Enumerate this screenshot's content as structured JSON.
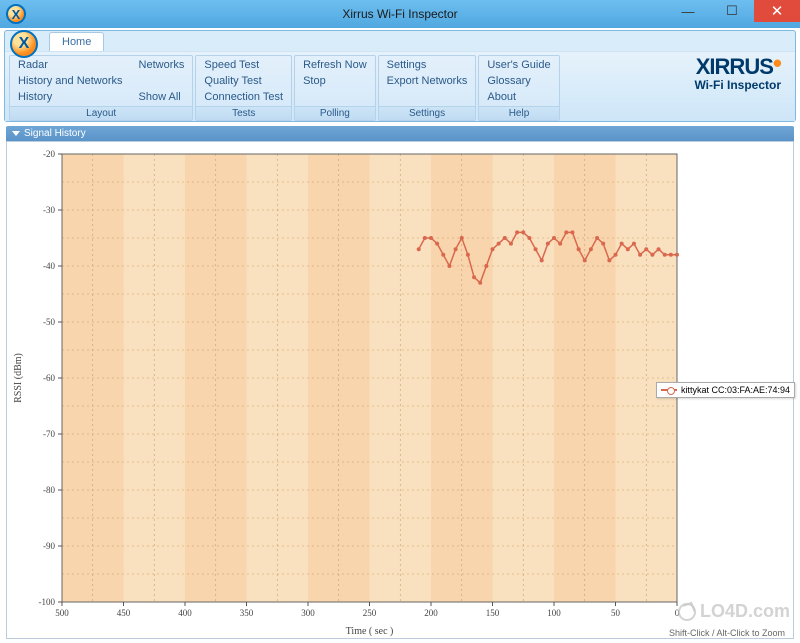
{
  "window": {
    "title": "Xirrus Wi-Fi Inspector"
  },
  "ribbon": {
    "file_tab": "Home",
    "groups": {
      "layout": {
        "label": "Layout",
        "col1": [
          "Radar",
          "History and Networks",
          "History"
        ],
        "col2": [
          "Networks",
          "",
          "Show All"
        ]
      },
      "tests": {
        "label": "Tests",
        "items": [
          "Speed Test",
          "Quality Test",
          "Connection Test"
        ]
      },
      "polling": {
        "label": "Polling",
        "items": [
          "Refresh Now",
          "Stop"
        ]
      },
      "settings": {
        "label": "Settings",
        "items": [
          "Settings",
          "Export Networks"
        ]
      },
      "help": {
        "label": "Help",
        "items": [
          "User's Guide",
          "Glossary",
          "About"
        ]
      }
    },
    "logo": {
      "name": "XIRRUS",
      "sub": "Wi-Fi Inspector"
    }
  },
  "panel": {
    "title": "Signal History"
  },
  "chart_data": {
    "type": "line",
    "title": "",
    "xlabel": "Time ( sec )",
    "ylabel": "RSSI (dBm)",
    "xlim": [
      500,
      0
    ],
    "ylim": [
      -100,
      -20
    ],
    "x_ticks": [
      500,
      450,
      400,
      350,
      300,
      250,
      200,
      150,
      100,
      50,
      0
    ],
    "y_ticks": [
      -20,
      -30,
      -40,
      -50,
      -60,
      -70,
      -80,
      -90,
      -100
    ],
    "series": [
      {
        "name": "kittykat CC:03:FA:AE:74:94",
        "color": "#d9684f",
        "x": [
          210,
          205,
          200,
          195,
          190,
          185,
          180,
          175,
          170,
          165,
          160,
          155,
          150,
          145,
          140,
          135,
          130,
          125,
          120,
          115,
          110,
          105,
          100,
          95,
          90,
          85,
          80,
          75,
          70,
          65,
          60,
          55,
          50,
          45,
          40,
          35,
          30,
          25,
          20,
          15,
          10,
          5,
          0
        ],
        "y": [
          -37,
          -35,
          -35,
          -36,
          -38,
          -40,
          -37,
          -35,
          -38,
          -42,
          -43,
          -40,
          -37,
          -36,
          -35,
          -36,
          -34,
          -34,
          -35,
          -37,
          -39,
          -36,
          -35,
          -36,
          -34,
          -34,
          -37,
          -39,
          -37,
          -35,
          -36,
          -39,
          -38,
          -36,
          -37,
          -36,
          -38,
          -37,
          -38,
          -37,
          -38,
          -38,
          -38
        ]
      }
    ]
  },
  "legend": {
    "label": "kittykat CC:03:FA:AE:74:94"
  },
  "footer": {
    "hint": "Shift-Click / Alt-Click to Zoom"
  },
  "watermark": "LO4D.com"
}
